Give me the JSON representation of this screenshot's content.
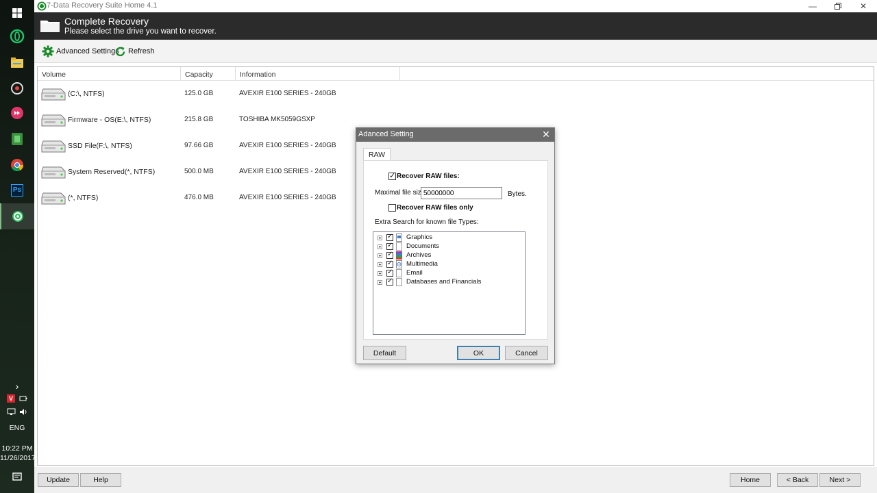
{
  "colors": {
    "header_bg": "#2b2b2b",
    "accent_green": "#1a8a2a",
    "taskbar_bg": "#101812",
    "dialog_title_bg": "#6b6b6b"
  },
  "taskbar": {
    "items": [
      {
        "icon": "windows-start-icon"
      },
      {
        "icon": "app-green-ring-icon"
      },
      {
        "icon": "file-explorer-icon"
      },
      {
        "icon": "recorder-icon"
      },
      {
        "icon": "media-player-icon"
      },
      {
        "icon": "evernote-icon"
      },
      {
        "icon": "chrome-icon"
      },
      {
        "icon": "photoshop-icon",
        "label": "Ps"
      },
      {
        "icon": "data-recovery-icon"
      }
    ],
    "tray": {
      "lang": "ENG",
      "time": "10:22 PM",
      "date": "11/26/2017",
      "vivaldi_label": "V"
    }
  },
  "window": {
    "title": "7-Data Recovery Suite Home 4.1",
    "header_title": "Complete Recovery",
    "header_subtitle": "Please select the drive you want to recover."
  },
  "toolbar": {
    "advanced_label": "Advanced Settings",
    "refresh_label": "Refresh"
  },
  "drive_table": {
    "columns": [
      "Volume",
      "Capacity",
      "Information"
    ],
    "rows": [
      {
        "volume": "(C:\\, NTFS)",
        "capacity": "125.0 GB",
        "info": "AVEXIR E100 SERIES - 240GB"
      },
      {
        "volume": "Firmware - OS(E:\\, NTFS)",
        "capacity": "215.8 GB",
        "info": "TOSHIBA MK5059GSXP"
      },
      {
        "volume": "SSD File(F:\\, NTFS)",
        "capacity": "97.66 GB",
        "info": "AVEXIR E100 SERIES - 240GB"
      },
      {
        "volume": "System Reserved(*, NTFS)",
        "capacity": "500.0 MB",
        "info": "AVEXIR E100 SERIES - 240GB"
      },
      {
        "volume": "(*, NTFS)",
        "capacity": "476.0 MB",
        "info": "AVEXIR E100 SERIES - 240GB"
      }
    ]
  },
  "bottom": {
    "update": "Update",
    "help": "Help",
    "home": "Home",
    "back": "< Back",
    "next": "Next >"
  },
  "dialog": {
    "title": "Adanced Setting",
    "tab": "RAW",
    "recover_raw": "Recover RAW files:",
    "recover_raw_checked": true,
    "max_size_label": "Maximal file size:",
    "max_size_value": "50000000",
    "bytes_label": "Bytes.",
    "raw_only": "Recover RAW files only",
    "raw_only_checked": false,
    "extra_label": "Extra Search for known file Types:",
    "file_types": [
      "Graphics",
      "Documents",
      "Archives",
      "Multimedia",
      "Email",
      "Databases and Financials"
    ],
    "default_btn": "Default",
    "ok_btn": "OK",
    "cancel_btn": "Cancel"
  }
}
